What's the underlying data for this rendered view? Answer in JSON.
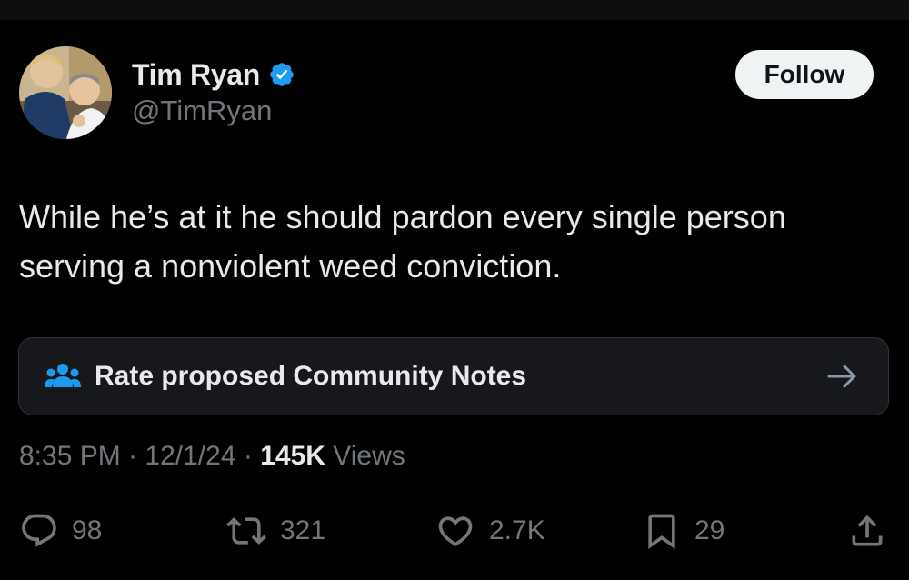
{
  "tweet": {
    "author": {
      "name": "Tim Ryan",
      "handle": "@TimRyan",
      "verified": true,
      "avatar": "profile-photo"
    },
    "follow_label": "Follow",
    "text": "While he’s at it he should pardon every single person serving a nonviolent weed conviction.",
    "community_notes": {
      "icon": "people-group-icon",
      "label": "Rate proposed Community Notes",
      "arrow": "arrow-right-icon"
    },
    "meta": {
      "time": "8:35 PM",
      "separator": "·",
      "date": "12/1/24",
      "views_count": "145K",
      "views_label": "Views"
    },
    "actions": {
      "reply": {
        "icon": "reply-icon",
        "count": "98"
      },
      "retweet": {
        "icon": "retweet-icon",
        "count": "321"
      },
      "like": {
        "icon": "heart-icon",
        "count": "2.7K"
      },
      "bookmark": {
        "icon": "bookmark-icon",
        "count": "29"
      },
      "share": {
        "icon": "share-icon"
      }
    }
  },
  "colors": {
    "background": "#000000",
    "text_primary": "#e7e9ea",
    "text_secondary": "#71767b",
    "verified_blue": "#1d9bf0",
    "follow_button_bg": "#eff3f4",
    "banner_bg": "#16181c",
    "banner_border": "#2f3336"
  }
}
